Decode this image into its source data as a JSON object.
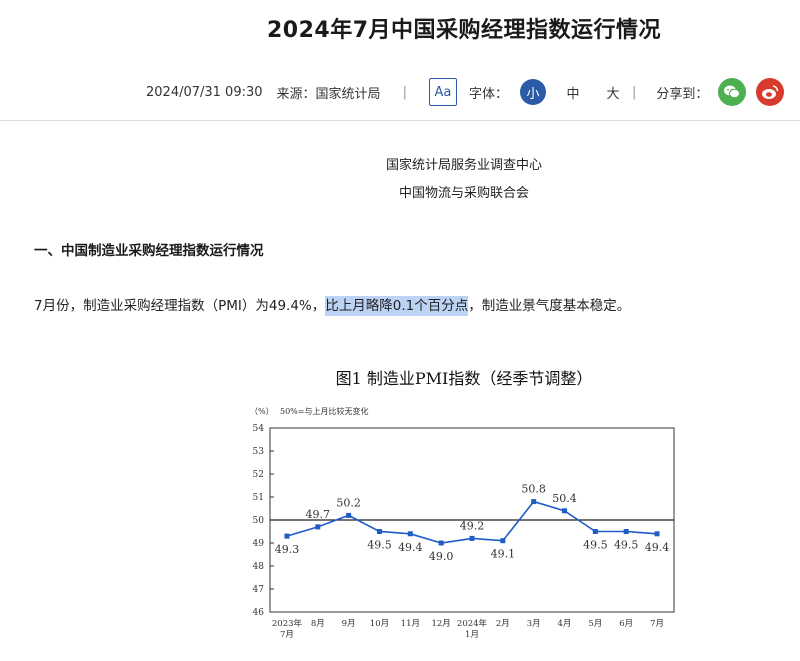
{
  "article": {
    "title": "2024年7月中国采购经理指数运行情况",
    "datetime": "2024/07/31 09:30",
    "source_label": "来源：",
    "source": "国家统计局",
    "font_label": "字体：",
    "font_sizes": [
      "小",
      "中",
      "大"
    ],
    "font_aa": "Aa",
    "share_label": "分享到：",
    "org_line1": "国家统计局服务业调查中心",
    "org_line2": "中国物流与采购联合会",
    "section_heading": "一、中国制造业采购经理指数运行情况",
    "para_before": "7月份，制造业采购经理指数（PMI）为49.4%，",
    "para_highlight": "比上月略降0.1个百分点",
    "para_after": "，制造业景气度基本稳定。",
    "figure_title": "图1  制造业PMI指数（经季节调整）"
  },
  "colors": {
    "accent": "#2a5aa8",
    "line": "#1f5cc8",
    "wechat": "#4caf50",
    "weibo": "#d93a2e",
    "highlight": "#bcd3f5"
  },
  "chart_data": {
    "type": "line",
    "unit_label": "（%）",
    "note": "50%=与上月比较无变化",
    "ylim": [
      46,
      54
    ],
    "yticks": [
      46,
      47,
      48,
      49,
      50,
      51,
      52,
      53,
      54
    ],
    "x_labels": [
      [
        "2023年",
        "7月"
      ],
      [
        "8月"
      ],
      [
        "9月"
      ],
      [
        "10月"
      ],
      [
        "11月"
      ],
      [
        "12月"
      ],
      [
        "2024年",
        "1月"
      ],
      [
        "2月"
      ],
      [
        "3月"
      ],
      [
        "4月"
      ],
      [
        "5月"
      ],
      [
        "6月"
      ],
      [
        "7月"
      ]
    ],
    "values": [
      49.3,
      49.7,
      50.2,
      49.5,
      49.4,
      49.0,
      49.2,
      49.1,
      50.8,
      50.4,
      49.5,
      49.5,
      49.4
    ],
    "value_labels": [
      "49.3",
      "49.7",
      "50.2",
      "49.5",
      "49.4",
      "49.0",
      "49.2",
      "49.1",
      "50.8",
      "50.4",
      "49.5",
      "49.5",
      "49.4"
    ],
    "reference_line": 50,
    "grid": false
  }
}
